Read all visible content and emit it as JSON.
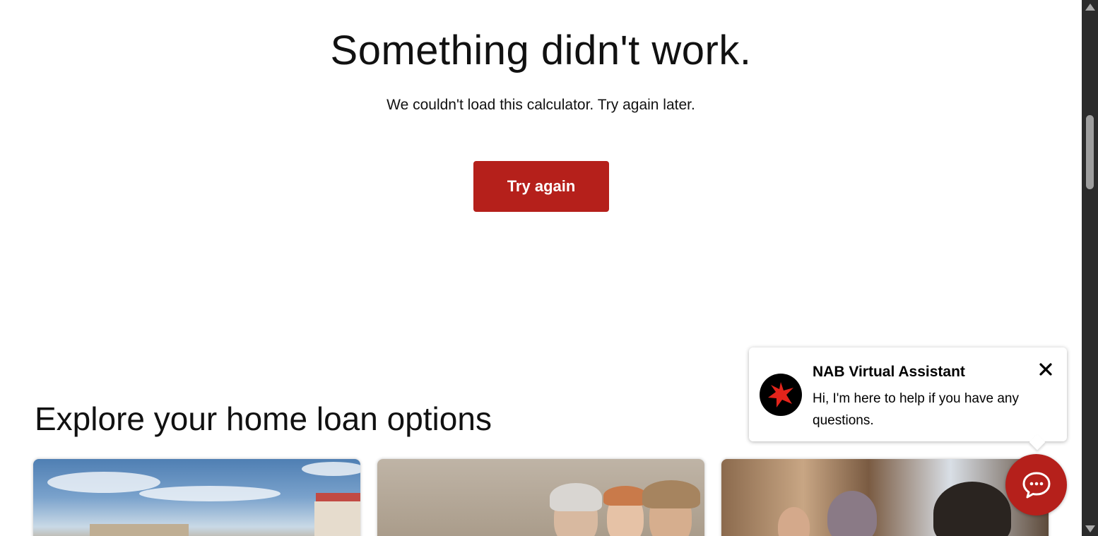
{
  "error": {
    "title": "Something didn't work.",
    "message": "We couldn't load this calculator. Try again later.",
    "retry_label": "Try again"
  },
  "explore": {
    "title": "Explore your home loan options",
    "cards": [
      {
        "image": "house-by-the-sea-photo"
      },
      {
        "image": "family-smiling-photo"
      },
      {
        "image": "family-at-home-photo"
      }
    ]
  },
  "chat": {
    "title": "NAB Virtual Assistant",
    "message": "Hi, I'm here to help if you have any questions.",
    "close_icon": "close-icon",
    "avatar_icon": "nab-star-logo",
    "launcher_icon": "chat-bubble-icon"
  },
  "colors": {
    "brand_red": "#b5201b",
    "avatar_bg": "#000000",
    "logo_red": "#e3241b"
  }
}
